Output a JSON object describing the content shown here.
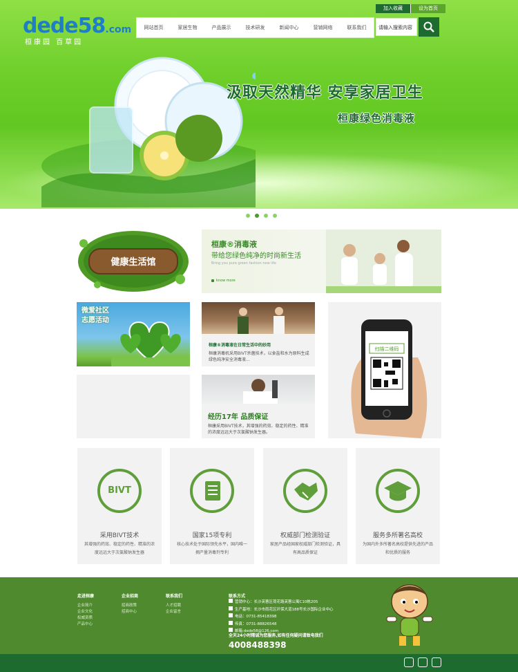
{
  "logo": {
    "brand": "dede58",
    "tld": ".com",
    "subtitle": "桓康园 百草园"
  },
  "toplinks": {
    "favorite": "加入收藏",
    "homepage": "设为首页"
  },
  "nav": [
    "网站首页",
    "家居生物",
    "产品展示",
    "技术研发",
    "新闻中心",
    "营销网络",
    "联系我们"
  ],
  "search": {
    "placeholder": "请输入搜索内容"
  },
  "banner": {
    "slogan1": "汲取天然精华 安享家居卫生",
    "slogan2": "桓康绿色消毒液"
  },
  "promo": {
    "wood_sign": "健康生活馆",
    "title": "桓康®消毒液",
    "subtitle": "带给您绿色纯净的时尚新生活",
    "english": "Bring you pure green fashion new life",
    "more": "know more"
  },
  "community": {
    "line1": "微爱社区",
    "line2": "志愿活动"
  },
  "news1": {
    "title": "桓康®消毒液在日常生活中的妙用",
    "desc": "桓康消毒机采用BIVT杀菌技术，以食盐和水为原料生成绿色纯净安全消毒液..."
  },
  "news2": {
    "title": "经历17年 品质保证",
    "desc": "桓康采用BIVT技术，其增强的药效、稳定的药性、精准的浓度远远大于次氯酸钠发生器。"
  },
  "qr": {
    "label": "扫描二维码"
  },
  "features": [
    {
      "icon": "bivt-icon",
      "badge": "BIVT",
      "title": "采用BIVT技术",
      "desc": "其增强的药效、稳定的药性、精准的浓度远远大于次氯酸钠发生器"
    },
    {
      "icon": "patent-book-icon",
      "title": "国家15项专利",
      "desc": "核心技术处于国际领先水平，国内唯一拥产量消毒剂专利"
    },
    {
      "icon": "handshake-icon",
      "title": "权威部门检测验证",
      "desc": "家居产品经国家权威部门检测验证，具有高品质保证"
    },
    {
      "icon": "graduation-cap-icon",
      "title": "服务多所著名高校",
      "desc": "为国内外多所著名高校提供先进的产品和优质的服务"
    }
  ],
  "footer": {
    "col1": {
      "title": "走进桓康",
      "items": [
        "企业简介",
        "企业文化",
        "权威资质",
        "产品中心"
      ]
    },
    "col2": {
      "title": "企业招商",
      "items": [
        "招商政策",
        "招商中心"
      ]
    },
    "col3": {
      "title": "联系我们",
      "items": [
        "人才招聘",
        "企业留言"
      ]
    },
    "contact": {
      "title": "联系方式",
      "lines": [
        "营销中心：长沙芙蓉区荷花路芙蓉公寓C10栋205",
        "生产基地：长沙市雨花区环保大道188号长沙国际企业中心",
        "电话：0731-85418398",
        "传真：0731-88826548",
        "邮箱:dede58@126.com"
      ],
      "hotline": "全天24小时精诚为您服务,如有任何疑问请致电我们",
      "phone": "4008488398"
    }
  },
  "colors": {
    "primary": "#1d6b2e",
    "accent": "#5f9e3a",
    "banner": "#6fcf2b"
  }
}
